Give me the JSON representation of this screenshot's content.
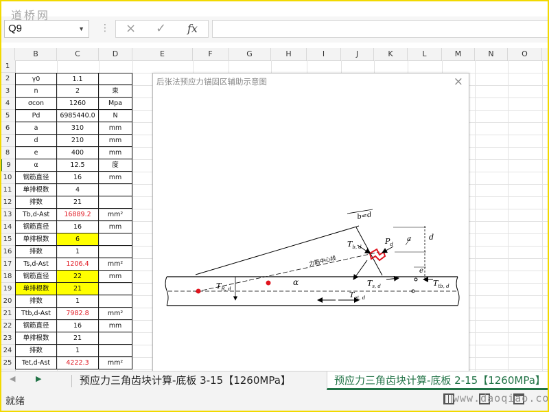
{
  "watermark_top": "道桥网",
  "watermark_bottom": "www.daoqiao.com",
  "formula_bar": {
    "name_box": "Q9",
    "cancel_icon": "×",
    "enter_icon": "✓",
    "fx_label": "fx",
    "formula": ""
  },
  "columns": [
    "B",
    "C",
    "D",
    "E",
    "F",
    "G",
    "H",
    "I",
    "J",
    "K",
    "L",
    "M",
    "N",
    "O"
  ],
  "row_numbers": [
    "1",
    "2",
    "3",
    "4",
    "5",
    "6",
    "7",
    "8",
    "9",
    "10",
    "11",
    "12",
    "13",
    "14",
    "15",
    "16",
    "17",
    "18",
    "19",
    "20",
    "21",
    "22",
    "23",
    "24",
    "25"
  ],
  "rows": [
    {
      "b": "",
      "c": "",
      "d": ""
    },
    {
      "b": "γ0",
      "c": "1.1",
      "d": ""
    },
    {
      "b": "n",
      "c": "2",
      "d": "束"
    },
    {
      "b": "σcon",
      "c": "1260",
      "d": "Mpa"
    },
    {
      "b": "Pd",
      "c": "6985440.0",
      "d": "N"
    },
    {
      "b": "a",
      "c": "310",
      "d": "mm"
    },
    {
      "b": "d",
      "c": "210",
      "d": "mm"
    },
    {
      "b": "e",
      "c": "400",
      "d": "mm"
    },
    {
      "b": "α",
      "c": "12.5",
      "d": "度"
    },
    {
      "b": "钢筋直径",
      "c": "16",
      "d": "mm"
    },
    {
      "b": "单排根数",
      "c": "4",
      "d": ""
    },
    {
      "b": "排数",
      "c": "21",
      "d": ""
    },
    {
      "b": "Tb,d-Ast",
      "c": "16889.2",
      "d": "mm²"
    },
    {
      "b": "钢筋直径",
      "c": "16",
      "d": "mm"
    },
    {
      "b": "单排根数",
      "c": "6",
      "d": ""
    },
    {
      "b": "排数",
      "c": "1",
      "d": ""
    },
    {
      "b": "Ts,d-Ast",
      "c": "1206.4",
      "d": "mm²"
    },
    {
      "b": "钢筋直径",
      "c": "22",
      "d": "mm"
    },
    {
      "b": "单排根数",
      "c": "21",
      "d": ""
    },
    {
      "b": "排数",
      "c": "1",
      "d": ""
    },
    {
      "b": "Ttb,d-Ast",
      "c": "7982.8",
      "d": "mm²"
    },
    {
      "b": "钢筋直径",
      "c": "16",
      "d": "mm"
    },
    {
      "b": "单排根数",
      "c": "21",
      "d": ""
    },
    {
      "b": "排数",
      "c": "1",
      "d": ""
    },
    {
      "b": "Tet,d-Ast",
      "c": "4222.3",
      "d": "mm²"
    }
  ],
  "dialog": {
    "title": "后张法预应力锚固区辅助示意图",
    "close_icon": "×",
    "labels": {
      "bd": "b=d",
      "tbd": "T",
      "tbd_sub": "b, d",
      "pd": "P",
      "pd_sub": "d",
      "a": "a",
      "d": "d",
      "e": "e",
      "force_line": "力筋中心线",
      "alpha": "α",
      "trd": "T",
      "trd_sub": "R, d",
      "tsd": "T",
      "tsd_sub": "s, d",
      "ttbd": "T",
      "ttbd_sub": "tb, d",
      "tetd": "T",
      "tetd_sub": "et, d"
    }
  },
  "sheet_tabs": [
    {
      "label": "预应力三角齿块计算-底板 3-15【1260MPa】",
      "active": false
    },
    {
      "label": "预应力三角齿块计算-底板 2-15【1260MPa】",
      "active": true
    }
  ],
  "status": {
    "ready": "就绪"
  },
  "colors": {
    "red_value": "#e0141e",
    "yellow_fill": "#ffff00",
    "excel_green": "#217346",
    "frame_yellow": "#f2d900"
  }
}
